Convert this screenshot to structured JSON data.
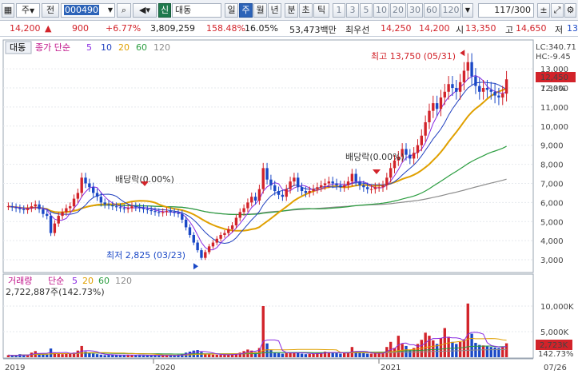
{
  "toolbar": {
    "market": "주",
    "prev_label": "전",
    "code": "000490",
    "badge": "신",
    "stock_name": "대동",
    "periods": [
      "일",
      "주",
      "월",
      "년",
      "분",
      "초",
      "틱"
    ],
    "selected_period": "주",
    "intervals": [
      "1",
      "3",
      "5",
      "10",
      "20",
      "30",
      "60",
      "120"
    ],
    "page_counter": "117/300"
  },
  "info": {
    "price": "14,200",
    "change": "900",
    "change_pct": "+6.77%",
    "volume": "3,809,259",
    "volume_ratio": "158.48%",
    "turnover": "16.05%",
    "market_cap": "53,473백만",
    "best_ask_label": "최우선",
    "best_ask": "14,250",
    "best_bid": "14,200",
    "open_label": "시",
    "open": "13,350",
    "high_label": "고",
    "high": "14,650",
    "low_label": "저",
    "low": "13"
  },
  "price_panel": {
    "name_tag": "대동",
    "legend_title": "종가 단순",
    "legend_periods": [
      "5",
      "10",
      "20",
      "60",
      "120"
    ],
    "legend_colors": [
      "#8a2be2",
      "#1f3fbf",
      "#e0a000",
      "#2a9d3f",
      "#8c8c8c"
    ],
    "lc_label": "LC:340.71",
    "hc_label": "HC:-9.45",
    "current_price_tag": "12,450",
    "current_pct_tag": "7.33%",
    "high_annotation": "최고 13,750 (05/31)",
    "low_annotation": "최저 2,825 (03/23)",
    "dividend_label_1": "배당락(0.00%)",
    "dividend_label_2": "배당락(0.00%)",
    "y_ticks": [
      "13,000",
      "12,000",
      "11,000",
      "10,000",
      "9,000",
      "8,000",
      "7,000",
      "6,000",
      "5,000",
      "4,000",
      "3,000"
    ]
  },
  "volume_panel": {
    "legend_title": "거래량",
    "legend_mode": "단순",
    "legend_periods": [
      "5",
      "20",
      "60",
      "120"
    ],
    "legend_colors": [
      "#8a2be2",
      "#e0a000",
      "#2a9d3f",
      "#8c8c8c"
    ],
    "summary": "2,722,887주(142.73%)",
    "y_ticks": [
      "10,000K",
      "5,000K"
    ],
    "current_tag": "2,723K",
    "current_pct_tag": "142.73%"
  },
  "x_axis": {
    "labels": [
      "2019",
      "2020",
      "2021",
      "07/26"
    ]
  },
  "colors": {
    "up": "#d2232a",
    "down": "#1a48c6",
    "accent": "#2c63b8"
  },
  "chart_data": {
    "type": "candlestick",
    "weeks": 130,
    "close": [
      5800,
      5750,
      5700,
      5650,
      5600,
      5700,
      5800,
      5900,
      5650,
      5400,
      5300,
      4400,
      4900,
      5300,
      5500,
      5700,
      5800,
      6200,
      6500,
      7300,
      7000,
      6800,
      6500,
      6300,
      6000,
      5900,
      5850,
      5800,
      5750,
      5700,
      5650,
      5700,
      5800,
      5750,
      5700,
      5650,
      5600,
      5550,
      5500,
      5450,
      5500,
      5550,
      5500,
      5450,
      5400,
      5100,
      4700,
      4300,
      3900,
      3500,
      3100,
      3400,
      3700,
      3900,
      4100,
      4300,
      4400,
      4600,
      4800,
      5200,
      5500,
      5700,
      6000,
      6300,
      6100,
      6700,
      7800,
      7200,
      6900,
      6600,
      6400,
      6300,
      6700,
      7100,
      7300,
      6800,
      6600,
      6500,
      6600,
      6700,
      6800,
      6900,
      7000,
      7100,
      7000,
      6900,
      6800,
      6900,
      7100,
      7500,
      7100,
      6900,
      6800,
      6700,
      6700,
      6800,
      6800,
      6900,
      7300,
      7800,
      8200,
      8400,
      8800,
      8500,
      8300,
      8600,
      9000,
      9500,
      10200,
      10800,
      11200,
      10900,
      11500,
      11800,
      12200,
      12000,
      11800,
      12300,
      12900,
      13350,
      12600,
      12100,
      11800,
      12000,
      11900,
      11800,
      11600,
      11500,
      11700,
      12450
    ],
    "volume_k": [
      400,
      350,
      300,
      600,
      500,
      400,
      900,
      1200,
      700,
      600,
      500,
      1700,
      900,
      800,
      600,
      700,
      800,
      900,
      1300,
      2200,
      1100,
      800,
      700,
      600,
      500,
      400,
      450,
      500,
      400,
      380,
      420,
      500,
      450,
      400,
      380,
      350,
      400,
      420,
      380,
      350,
      330,
      320,
      360,
      380,
      500,
      700,
      900,
      1100,
      1300,
      1400,
      1000,
      700,
      600,
      500,
      480,
      460,
      500,
      520,
      600,
      700,
      900,
      1200,
      1500,
      1300,
      1000,
      1800,
      10000,
      2700,
      1400,
      1000,
      800,
      700,
      800,
      900,
      1000,
      900,
      700,
      600,
      650,
      700,
      800,
      900,
      1100,
      1000,
      900,
      800,
      700,
      800,
      1000,
      2000,
      1100,
      900,
      800,
      700,
      700,
      800,
      800,
      900,
      2000,
      3000,
      1800,
      4200,
      2600,
      2200,
      1400,
      1800,
      2600,
      3400,
      4800,
      4200,
      3300,
      2600,
      3700,
      5700,
      4000,
      3000,
      2600,
      3000,
      3500,
      10500,
      4600,
      2800,
      2400,
      2300,
      2100,
      2000,
      1900,
      1800,
      2100,
      2723
    ],
    "ma": {
      "5": "computed from close",
      "10": "computed from close",
      "20": "computed from close",
      "60": "computed from close",
      "120": "computed from close"
    },
    "price_ylim": [
      2500,
      13800
    ],
    "volume_ylim": [
      0,
      12500
    ],
    "high_marker": {
      "value": 13750,
      "date": "05/31"
    },
    "low_marker": {
      "value": 2825,
      "date": "03/23"
    }
  }
}
